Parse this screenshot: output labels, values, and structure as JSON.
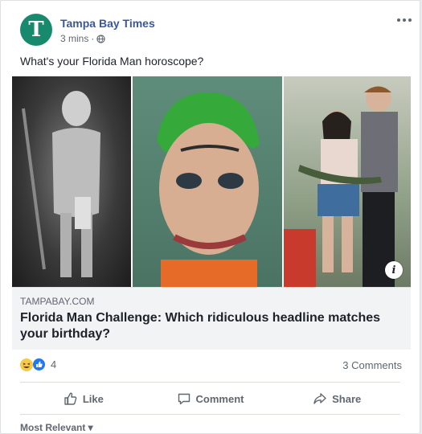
{
  "post": {
    "page_name": "Tampa Bay Times",
    "avatar_letter": "T",
    "time": "3 mins",
    "meta_sep": "·",
    "text": "What's your Florida Man horoscope?"
  },
  "link": {
    "domain": "TAMPABAY.COM",
    "title": "Florida Man Challenge: Which ridiculous headline matches your birthday?"
  },
  "engagement": {
    "reaction_count": "4",
    "comments": "3 Comments"
  },
  "actions": {
    "like": "Like",
    "comment": "Comment",
    "share": "Share"
  },
  "comments_sort": "Most Relevant ▾",
  "colors": {
    "page_name": "#385898",
    "avatar": "#178a6e",
    "like_blue": "#2078f4",
    "haha_yellow": "#f7c948"
  }
}
